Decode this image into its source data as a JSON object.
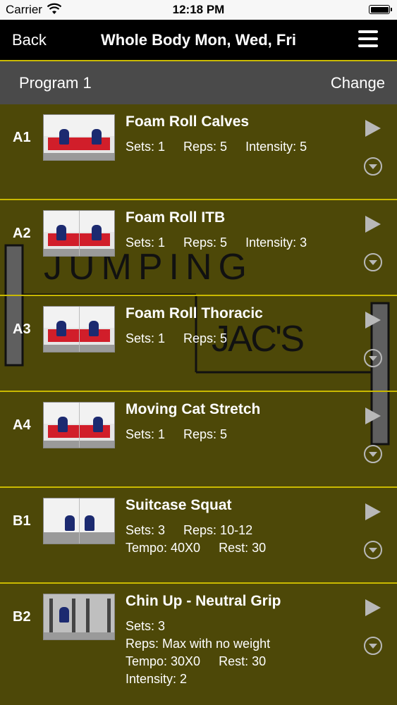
{
  "status_bar": {
    "carrier": "Carrier",
    "time": "12:18 PM"
  },
  "nav": {
    "back_label": "Back",
    "title": "Whole Body Mon, Wed, Fri"
  },
  "program_bar": {
    "program_name": "Program 1",
    "change_label": "Change"
  },
  "watermark": {
    "line1": "JUMPING",
    "line2": "JAC'S"
  },
  "colors": {
    "row_background": "#4d4808",
    "divider": "#c9b900",
    "header_bar": "#4a4a4a"
  },
  "exercises": [
    {
      "code": "A1",
      "name": "Foam Roll Calves",
      "line1": [
        "Sets: 1",
        "Reps: 5",
        "Intensity: 5"
      ],
      "line2": [],
      "line3": "",
      "line4": ""
    },
    {
      "code": "A2",
      "name": "Foam Roll ITB",
      "line1": [
        "Sets: 1",
        "Reps: 5",
        "Intensity: 3"
      ],
      "line2": [],
      "line3": "",
      "line4": ""
    },
    {
      "code": "A3",
      "name": "Foam Roll Thoracic",
      "line1": [
        "Sets: 1",
        "Reps: 5"
      ],
      "line2": [],
      "line3": "",
      "line4": ""
    },
    {
      "code": "A4",
      "name": "Moving Cat Stretch",
      "line1": [
        "Sets: 1",
        "Reps: 5"
      ],
      "line2": [],
      "line3": "",
      "line4": ""
    },
    {
      "code": "B1",
      "name": "Suitcase Squat",
      "line1": [
        "Sets: 3",
        "Reps: 10-12"
      ],
      "line2": [
        "Tempo: 40X0",
        "Rest: 30"
      ],
      "line3": "",
      "line4": ""
    },
    {
      "code": "B2",
      "name": "Chin Up - Neutral Grip",
      "line1": [
        "Sets: 3"
      ],
      "line2": [],
      "line3": "Reps: Max with no weight",
      "line4": "",
      "line5": [
        "Tempo: 30X0",
        "Rest: 30"
      ],
      "line6": "Intensity: 2"
    }
  ]
}
